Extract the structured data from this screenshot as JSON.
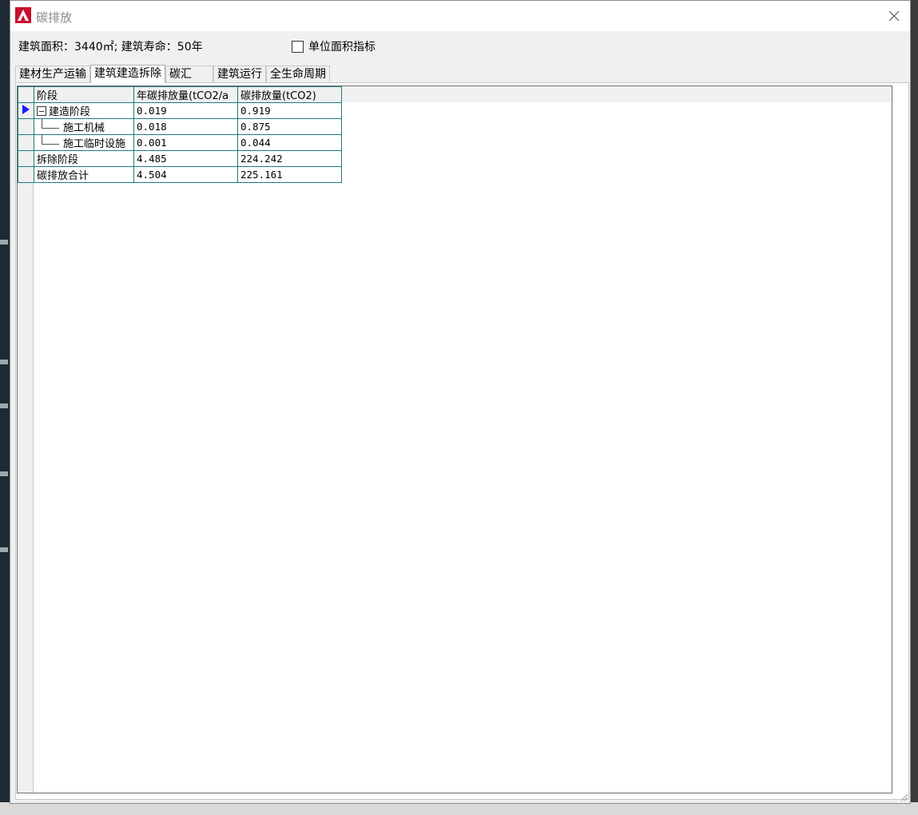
{
  "window": {
    "title": "碳排放"
  },
  "info": {
    "summary": "建筑面积：3440㎡; 建筑寿命：50年",
    "unit_checkbox_label": "单位面积指标",
    "unit_checkbox_checked": false
  },
  "tabs": [
    {
      "label": "建材生产运输",
      "active": false
    },
    {
      "label": "建筑建造拆除",
      "active": true
    },
    {
      "label": "碳汇",
      "active": false
    },
    {
      "label": "建筑运行",
      "active": false
    },
    {
      "label": "全生命周期",
      "active": false
    }
  ],
  "table": {
    "headers": [
      "阶段",
      "年碳排放量(tCO2/a",
      "碳排放量(tCO2)"
    ],
    "rows": [
      {
        "name": "建造阶段",
        "annual": "0.019",
        "total": "0.919"
      },
      {
        "name": "施工机械",
        "annual": "0.018",
        "total": "0.875"
      },
      {
        "name": "施工临时设施",
        "annual": "0.001",
        "total": "0.044"
      },
      {
        "name": "拆除阶段",
        "annual": "4.485",
        "total": "224.242"
      },
      {
        "name": "碳排放合计",
        "annual": "4.504",
        "total": "225.161"
      }
    ]
  },
  "colors": {
    "grid_line": "#1f7a7a",
    "selection_arrow": "#1a1aff"
  }
}
